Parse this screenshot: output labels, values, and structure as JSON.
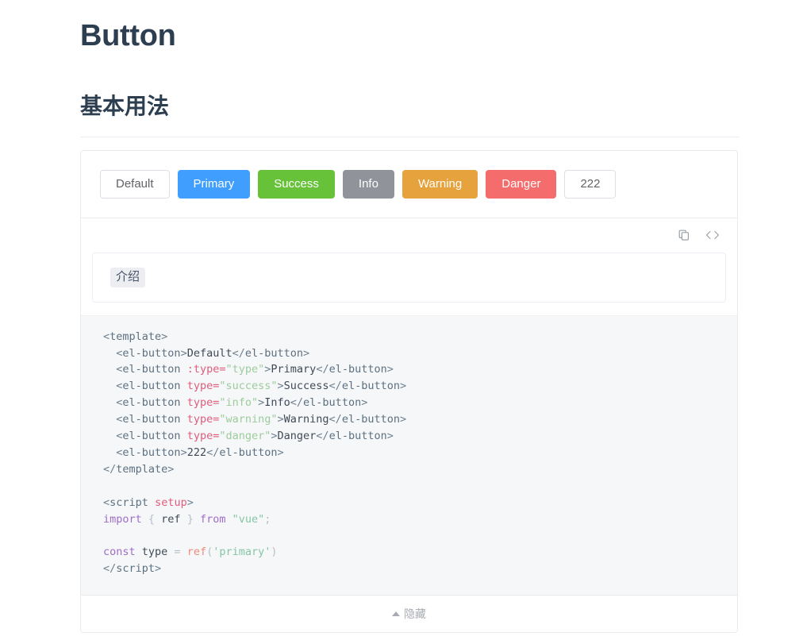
{
  "page": {
    "title": "Button",
    "section_title": "基本用法"
  },
  "demo": {
    "buttons": [
      {
        "label": "Default",
        "variant": "default",
        "color": "#ffffff"
      },
      {
        "label": "Primary",
        "variant": "primary",
        "color": "#409eff"
      },
      {
        "label": "Success",
        "variant": "success",
        "color": "#67c23a"
      },
      {
        "label": "Info",
        "variant": "info",
        "color": "#909399"
      },
      {
        "label": "Warning",
        "variant": "warning",
        "color": "#e6a23c"
      },
      {
        "label": "Danger",
        "variant": "danger",
        "color": "#f56c6c"
      },
      {
        "label": "222",
        "variant": "default",
        "color": "#ffffff"
      }
    ],
    "toolbar": {
      "copy_icon": "copy-icon",
      "code_icon": "code-brackets-icon"
    },
    "intro": {
      "code_text": "介绍"
    },
    "footer": {
      "toggle_label": "隐藏",
      "caret_icon": "caret-up-icon"
    }
  },
  "code": {
    "language": "vue",
    "lines": [
      {
        "tokens": [
          {
            "t": "tag",
            "v": "<"
          },
          {
            "t": "name",
            "v": "template"
          },
          {
            "t": "tag",
            "v": ">"
          }
        ]
      },
      {
        "tokens": [
          {
            "t": "txt",
            "v": "  "
          },
          {
            "t": "tag",
            "v": "<"
          },
          {
            "t": "name",
            "v": "el-button"
          },
          {
            "t": "tag",
            "v": ">"
          },
          {
            "t": "txt",
            "v": "Default"
          },
          {
            "t": "tag",
            "v": "</"
          },
          {
            "t": "name",
            "v": "el-button"
          },
          {
            "t": "tag",
            "v": ">"
          }
        ]
      },
      {
        "tokens": [
          {
            "t": "txt",
            "v": "  "
          },
          {
            "t": "tag",
            "v": "<"
          },
          {
            "t": "name",
            "v": "el-button"
          },
          {
            "t": "txt",
            "v": " "
          },
          {
            "t": "attr",
            "v": ":type="
          },
          {
            "t": "str",
            "v": "\"type\""
          },
          {
            "t": "tag",
            "v": ">"
          },
          {
            "t": "txt",
            "v": "Primary"
          },
          {
            "t": "tag",
            "v": "</"
          },
          {
            "t": "name",
            "v": "el-button"
          },
          {
            "t": "tag",
            "v": ">"
          }
        ]
      },
      {
        "tokens": [
          {
            "t": "txt",
            "v": "  "
          },
          {
            "t": "tag",
            "v": "<"
          },
          {
            "t": "name",
            "v": "el-button"
          },
          {
            "t": "txt",
            "v": " "
          },
          {
            "t": "attr",
            "v": "type="
          },
          {
            "t": "str",
            "v": "\"success\""
          },
          {
            "t": "tag",
            "v": ">"
          },
          {
            "t": "txt",
            "v": "Success"
          },
          {
            "t": "tag",
            "v": "</"
          },
          {
            "t": "name",
            "v": "el-button"
          },
          {
            "t": "tag",
            "v": ">"
          }
        ]
      },
      {
        "tokens": [
          {
            "t": "txt",
            "v": "  "
          },
          {
            "t": "tag",
            "v": "<"
          },
          {
            "t": "name",
            "v": "el-button"
          },
          {
            "t": "txt",
            "v": " "
          },
          {
            "t": "attr",
            "v": "type="
          },
          {
            "t": "str",
            "v": "\"info\""
          },
          {
            "t": "tag",
            "v": ">"
          },
          {
            "t": "txt",
            "v": "Info"
          },
          {
            "t": "tag",
            "v": "</"
          },
          {
            "t": "name",
            "v": "el-button"
          },
          {
            "t": "tag",
            "v": ">"
          }
        ]
      },
      {
        "tokens": [
          {
            "t": "txt",
            "v": "  "
          },
          {
            "t": "tag",
            "v": "<"
          },
          {
            "t": "name",
            "v": "el-button"
          },
          {
            "t": "txt",
            "v": " "
          },
          {
            "t": "attr",
            "v": "type="
          },
          {
            "t": "str",
            "v": "\"warning\""
          },
          {
            "t": "tag",
            "v": ">"
          },
          {
            "t": "txt",
            "v": "Warning"
          },
          {
            "t": "tag",
            "v": "</"
          },
          {
            "t": "name",
            "v": "el-button"
          },
          {
            "t": "tag",
            "v": ">"
          }
        ]
      },
      {
        "tokens": [
          {
            "t": "txt",
            "v": "  "
          },
          {
            "t": "tag",
            "v": "<"
          },
          {
            "t": "name",
            "v": "el-button"
          },
          {
            "t": "txt",
            "v": " "
          },
          {
            "t": "attr",
            "v": "type="
          },
          {
            "t": "str",
            "v": "\"danger\""
          },
          {
            "t": "tag",
            "v": ">"
          },
          {
            "t": "txt",
            "v": "Danger"
          },
          {
            "t": "tag",
            "v": "</"
          },
          {
            "t": "name",
            "v": "el-button"
          },
          {
            "t": "tag",
            "v": ">"
          }
        ]
      },
      {
        "tokens": [
          {
            "t": "txt",
            "v": "  "
          },
          {
            "t": "tag",
            "v": "<"
          },
          {
            "t": "name",
            "v": "el-button"
          },
          {
            "t": "tag",
            "v": ">"
          },
          {
            "t": "txt",
            "v": "222"
          },
          {
            "t": "tag",
            "v": "</"
          },
          {
            "t": "name",
            "v": "el-button"
          },
          {
            "t": "tag",
            "v": ">"
          }
        ]
      },
      {
        "tokens": [
          {
            "t": "tag",
            "v": "</"
          },
          {
            "t": "name",
            "v": "template"
          },
          {
            "t": "tag",
            "v": ">"
          }
        ]
      },
      {
        "tokens": []
      },
      {
        "tokens": [
          {
            "t": "tag",
            "v": "<"
          },
          {
            "t": "name",
            "v": "script"
          },
          {
            "t": "txt",
            "v": " "
          },
          {
            "t": "attr",
            "v": "setup"
          },
          {
            "t": "tag",
            "v": ">"
          }
        ]
      },
      {
        "tokens": [
          {
            "t": "kw",
            "v": "import"
          },
          {
            "t": "punc",
            "v": " { "
          },
          {
            "t": "var",
            "v": "ref"
          },
          {
            "t": "punc",
            "v": " } "
          },
          {
            "t": "kw",
            "v": "from"
          },
          {
            "t": "txt",
            "v": " "
          },
          {
            "t": "str2",
            "v": "\"vue\""
          },
          {
            "t": "punc",
            "v": ";"
          }
        ]
      },
      {
        "tokens": []
      },
      {
        "tokens": [
          {
            "t": "kw",
            "v": "const"
          },
          {
            "t": "txt",
            "v": " "
          },
          {
            "t": "var",
            "v": "type"
          },
          {
            "t": "punc",
            "v": " = "
          },
          {
            "t": "fn",
            "v": "ref"
          },
          {
            "t": "punc",
            "v": "("
          },
          {
            "t": "str2",
            "v": "'primary'"
          },
          {
            "t": "punc",
            "v": ")"
          }
        ]
      },
      {
        "tokens": [
          {
            "t": "tag",
            "v": "</"
          },
          {
            "t": "name",
            "v": "script"
          },
          {
            "t": "tag",
            "v": ">"
          }
        ]
      }
    ]
  }
}
